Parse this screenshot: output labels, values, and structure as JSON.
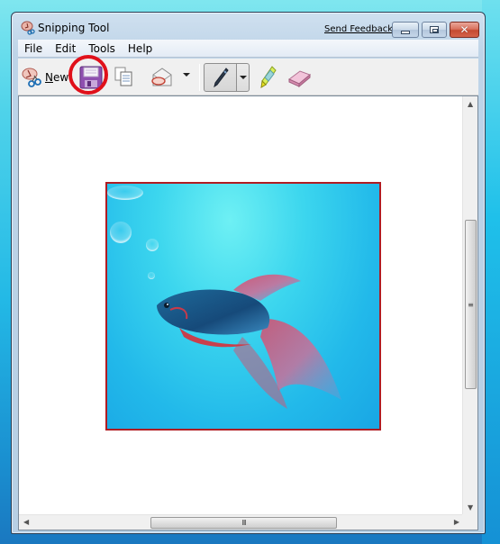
{
  "window": {
    "title": "Snipping Tool",
    "send_feedback": "Send Feedback",
    "controls": {
      "minimize": "minimize",
      "maximize": "maximize",
      "close": "close"
    },
    "close_glyph": "✕"
  },
  "menubar": {
    "items": [
      {
        "label": "File"
      },
      {
        "label": "Edit"
      },
      {
        "label": "Tools"
      },
      {
        "label": "Help"
      }
    ]
  },
  "toolbar": {
    "new_label_mnemonic": "N",
    "new_label_rest": "ew",
    "buttons": [
      {
        "name": "new",
        "icon": "scissors-icon"
      },
      {
        "name": "save",
        "icon": "floppy-disk-icon",
        "highlighted": true
      },
      {
        "name": "copy",
        "icon": "copy-icon"
      },
      {
        "name": "send",
        "icon": "envelope-icon"
      },
      {
        "name": "pen",
        "icon": "pen-icon",
        "active": true
      },
      {
        "name": "highlighter",
        "icon": "highlighter-icon"
      },
      {
        "name": "eraser",
        "icon": "eraser-icon"
      }
    ],
    "annotation_color": "#e0101a"
  },
  "canvas": {
    "image_description": "Betta fish swimming in blue water with bubbles",
    "border_color": "#b01c22"
  },
  "scrollbars": {
    "vertical_grip": "≡",
    "horizontal_grip": "III"
  }
}
